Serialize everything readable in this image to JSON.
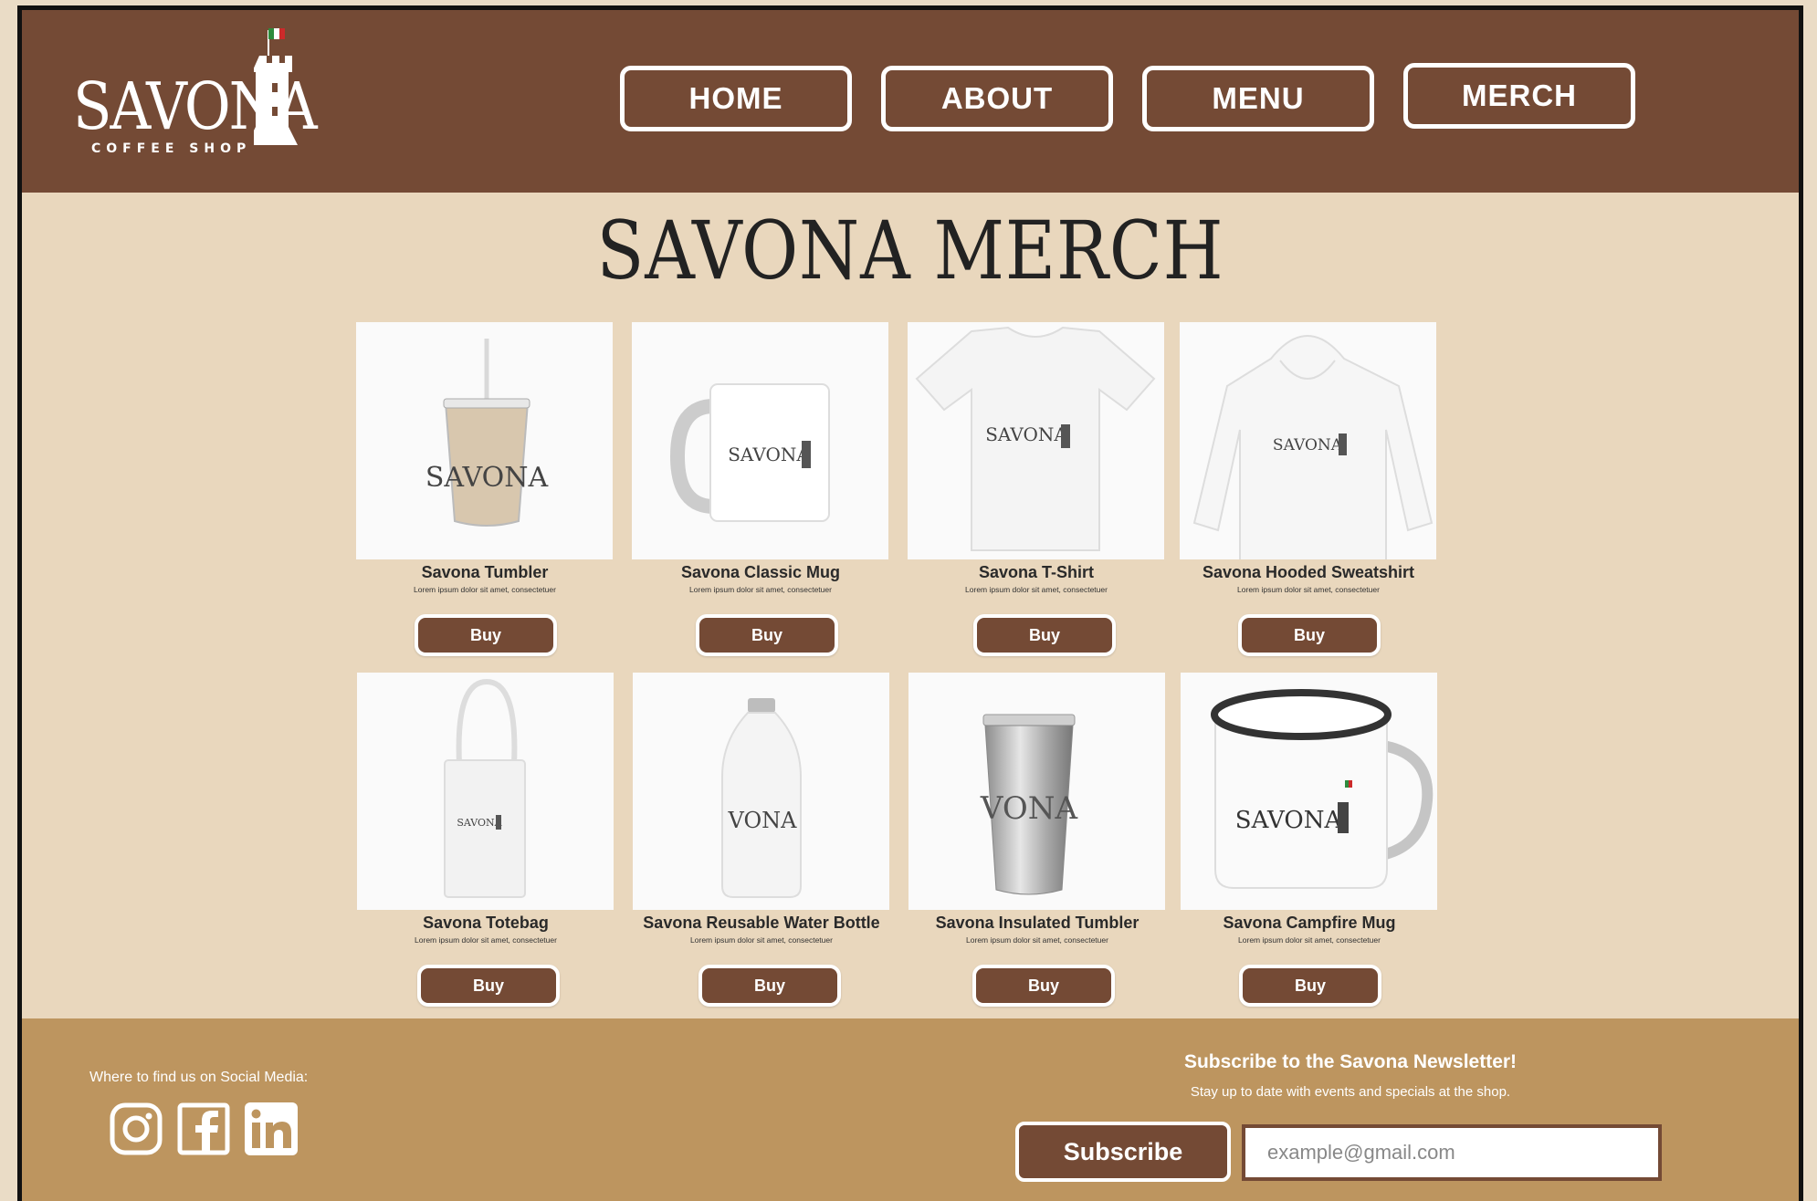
{
  "brand": {
    "name": "SAVONA",
    "tagline": "COFFEE SHOP",
    "colors": {
      "brown": "#744a35",
      "tan": "#e9d7bd",
      "footer": "#bd955f",
      "flag_green": "#2e8b3d",
      "flag_red": "#cc2a2a"
    }
  },
  "nav": {
    "items": [
      {
        "label": "HOME"
      },
      {
        "label": "ABOUT"
      },
      {
        "label": "MENU"
      },
      {
        "label": "MERCH"
      }
    ]
  },
  "page": {
    "title": "SAVONA MERCH"
  },
  "products": [
    {
      "name": "Savona Tumbler",
      "description": "Lorem ipsum dolor sit amet, consectetuer",
      "buy_label": "Buy",
      "icon": "tumbler-image"
    },
    {
      "name": "Savona Classic Mug",
      "description": "Lorem ipsum dolor sit amet, consectetuer",
      "buy_label": "Buy",
      "icon": "mug-image"
    },
    {
      "name": "Savona T-Shirt",
      "description": "Lorem ipsum dolor sit amet, consectetuer",
      "buy_label": "Buy",
      "icon": "tshirt-image"
    },
    {
      "name": "Savona Hooded Sweatshirt",
      "description": "Lorem ipsum dolor sit amet, consectetuer",
      "buy_label": "Buy",
      "icon": "hoodie-image"
    },
    {
      "name": "Savona Totebag",
      "description": "Lorem ipsum dolor sit amet, consectetuer",
      "buy_label": "Buy",
      "icon": "totebag-image"
    },
    {
      "name": "Savona Reusable Water Bottle",
      "description": "Lorem ipsum dolor sit amet, consectetuer",
      "buy_label": "Buy",
      "icon": "bottle-image"
    },
    {
      "name": "Savona Insulated Tumbler",
      "description": "Lorem ipsum dolor sit amet, consectetuer",
      "buy_label": "Buy",
      "icon": "insulated-tumbler-image"
    },
    {
      "name": "Savona Campfire Mug",
      "description": "Lorem ipsum dolor sit amet, consectetuer",
      "buy_label": "Buy",
      "icon": "campfire-mug-image"
    }
  ],
  "footer": {
    "social_label": "Where to find us on Social Media:",
    "social": [
      {
        "name": "instagram-icon"
      },
      {
        "name": "facebook-icon"
      },
      {
        "name": "linkedin-icon"
      }
    ],
    "newsletter_title": "Subscribe to the Savona Newsletter!",
    "newsletter_sub": "Stay up to date with events and specials at the shop.",
    "subscribe_label": "Subscribe",
    "email_placeholder": "example@gmail.com"
  }
}
